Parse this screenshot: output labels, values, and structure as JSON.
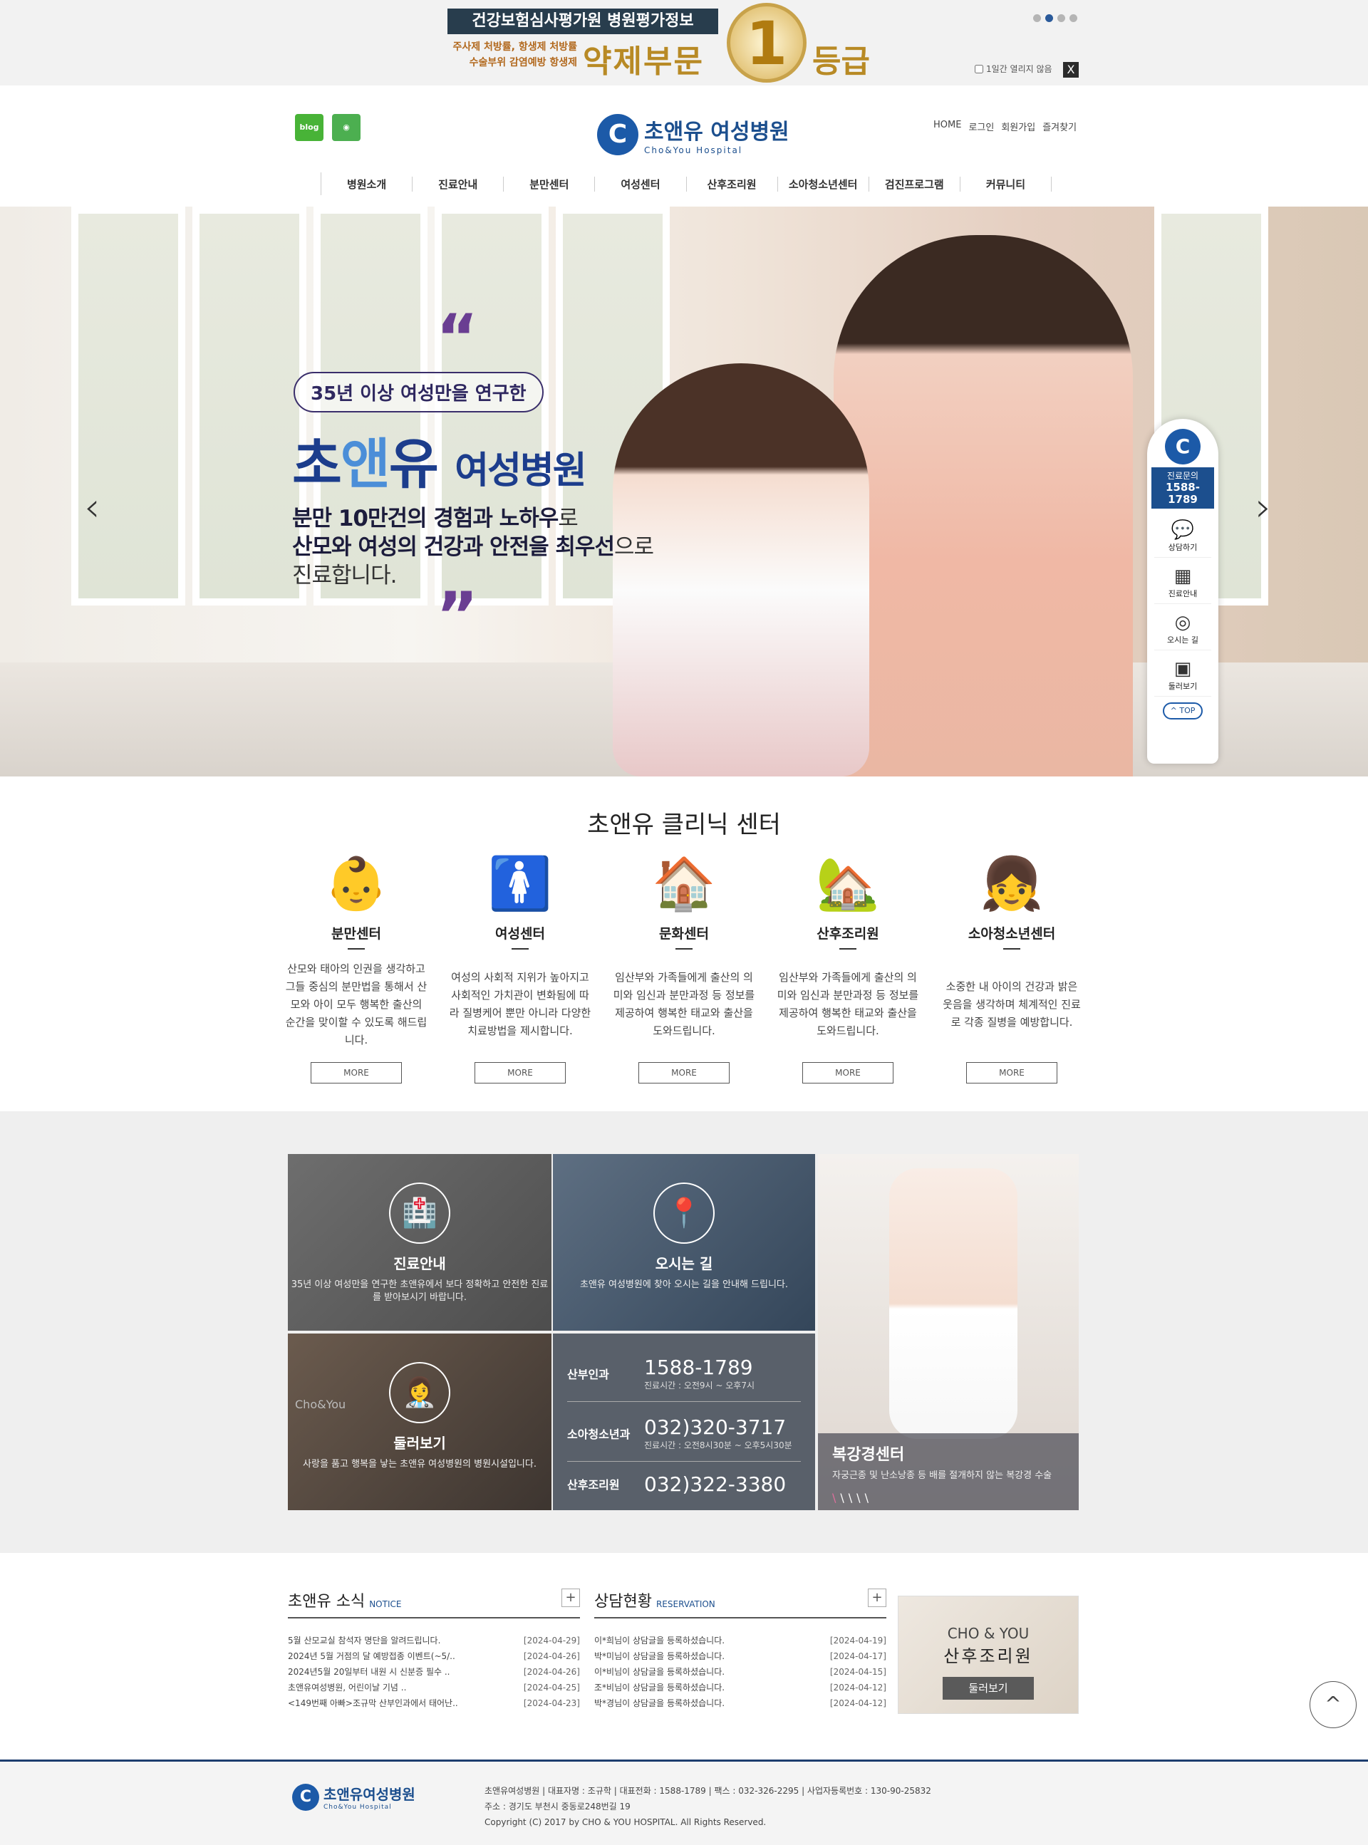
{
  "top_banner": {
    "title": "건강보험심사평가원 병원평가정보",
    "sub1": "주사제 처방률, 항생제 처방률",
    "sub2": "수술부위 감염예방 항생제",
    "main": "약제부문",
    "rank": "1",
    "grade": "등급",
    "close_check": "1일간 열리지 않음",
    "close_x": "X"
  },
  "header": {
    "blog": "blog",
    "logo_ko": "초앤유 여성병원",
    "logo_en": "Cho&You Hospital",
    "util": [
      "HOME",
      "로그인",
      "회원가입",
      "즐겨찾기"
    ],
    "nav": [
      "병원소개",
      "진료안내",
      "분만센터",
      "여성센터",
      "산후조리원",
      "소아청소년센터",
      "검진프로그램",
      "커뮤니티"
    ]
  },
  "hero": {
    "pill": "35년 이상 여성만을 연구한",
    "title_a": "초",
    "title_b": "앤",
    "title_c": "유",
    "title_d": "여성병원",
    "desc1_b": "분만 10만건의 경험과 노하우",
    "desc1": "로",
    "desc2_b": "산모와 여성의 건강과 안전을 최우선",
    "desc2": "으로",
    "desc3": "진료합니다."
  },
  "quick": {
    "tel_label": "진료문의",
    "tel": "1588-1789",
    "items": [
      "상담하기",
      "진료안내",
      "오시는 길",
      "둘러보기"
    ],
    "top": "TOP"
  },
  "centers": {
    "title": "초앤유 클리닉 센터",
    "more": "MORE",
    "items": [
      {
        "title": "분만센터",
        "desc": "산모와 태아의 인권을 생각하고 그들 중심의 분만법을 통해서 산모와 아이 모두 행복한 출산의 순간을 맞이할 수 있도록 해드립니다."
      },
      {
        "title": "여성센터",
        "desc": "여성의 사회적 지위가 높아지고 사회적인 가치관이 변화됨에 따라 질병케어 뿐만 아니라 다양한 치료방법을 제시합니다."
      },
      {
        "title": "문화센터",
        "desc": "임산부와 가족들에게 출산의 의미와 임신과 분만과정 등 정보를 제공하여 행복한 태교와 출산을 도와드립니다."
      },
      {
        "title": "산후조리원",
        "desc": "임산부와 가족들에게 출산의 의미와 임신과 분만과정 등 정보를 제공하여 행복한 태교와 출산을 도와드립니다."
      },
      {
        "title": "소아청소년센터",
        "desc": "소중한 내 아이의 건강과 밝은 웃음을 생각하며 체계적인 진료로 각종 질병을 예방합니다."
      }
    ]
  },
  "tiles": {
    "guide_title": "진료안내",
    "guide_desc": "35년 이상 여성만을 연구한 초앤유에서 보다 정확하고 안전한 진료를 받아보시기 바랍니다.",
    "map_title": "오시는 길",
    "map_desc": "초앤유 여성병원에 찾아 오시는 길을 안내해 드립니다.",
    "tour_watermark": "Cho&You",
    "tour_title": "둘러보기",
    "tour_desc": "사랑을 품고 행복을 낳는 초앤유 여성병원의 병원시설입니다.",
    "phones": [
      {
        "label": "산부인과",
        "number": "1588-1789",
        "hours": "진료시간 : 오전9시 ~ 오후7시"
      },
      {
        "label": "소아청소년과",
        "number": "032)320-3717",
        "hours": "진료시간 : 오전8시30분 ~ 오후5시30분"
      },
      {
        "label": "산후조리원",
        "number": "032)322-3380",
        "hours": ""
      }
    ],
    "abdomen_title": "복강경센터",
    "abdomen_desc": "자궁근종 및 난소낭종 등 배를 절개하지 않는 복강경 수술"
  },
  "boards": {
    "notice_title": "초앤유 소식",
    "notice_en": "NOTICE",
    "notice": [
      {
        "title": "5월 산모교실 참석자 명단을 알려드립니다.",
        "date": "[2024-04-29]"
      },
      {
        "title": "2024년 5월 거점의 달 예방접종 이벤트(~5/..",
        "date": "[2024-04-26]"
      },
      {
        "title": "2024년5월 20일부터 내원 시 신분증 필수 ..",
        "date": "[2024-04-26]"
      },
      {
        "title": "초앤유여성병원, 어린이날 기념 ..",
        "date": "[2024-04-25]"
      },
      {
        "title": "<149번째 아빠>조규막 산부인과에서 태어난..",
        "date": "[2024-04-23]"
      }
    ],
    "consult_title": "상담현황",
    "consult_en": "RESERVATION",
    "consult": [
      {
        "title": "이*희님이 상담글을 등록하셨습니다.",
        "date": "[2024-04-19]"
      },
      {
        "title": "박*미님이 상담글을 등록하셨습니다.",
        "date": "[2024-04-17]"
      },
      {
        "title": "이*비님이 상담글을 등록하셨습니다.",
        "date": "[2024-04-15]"
      },
      {
        "title": "조*비님이 상담글을 등록하셨습니다.",
        "date": "[2024-04-12]"
      },
      {
        "title": "박*경님이 상담글을 등록하셨습니다.",
        "date": "[2024-04-12]"
      }
    ],
    "plus": "+"
  },
  "postnatal": {
    "line1": "CHO & YOU",
    "line2": "산후조리원",
    "button": "둘러보기"
  },
  "footer": {
    "logo_ko": "초앤유여성병원",
    "logo_en": "Cho&You Hospital",
    "line1": "초앤유여성병원 | 대표자명 : 조규학 | 대표전화 : 1588-1789 | 팩스 : 032-326-2295 | 사업자등록번호 : 130-90-25832",
    "line2": "주소 : 경기도 부천시 중동로248번길 19",
    "line3": "Copyright (C) 2017 by CHO & YOU HOSPITAL. All Rights Reserved."
  }
}
